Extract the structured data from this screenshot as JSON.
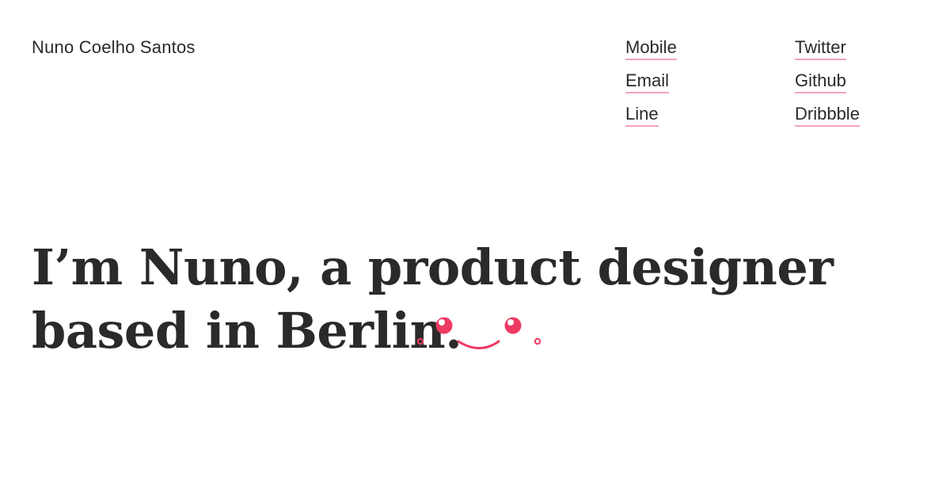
{
  "header": {
    "site_name": "Nuno Coelho Santos"
  },
  "nav": {
    "col1": [
      {
        "label": "Mobile"
      },
      {
        "label": "Email"
      },
      {
        "label": "Line"
      }
    ],
    "col2": [
      {
        "label": "Twitter"
      },
      {
        "label": "Github"
      },
      {
        "label": "Dribbble"
      }
    ]
  },
  "hero": {
    "line1": "I’m Nuno, a product designer",
    "line2": "based in Berlin."
  },
  "colors": {
    "accent": "#ee3a62",
    "underline": "#f4a3b7",
    "text": "#2a2a2a"
  },
  "icons": {
    "face": "smiley-face-icon"
  }
}
